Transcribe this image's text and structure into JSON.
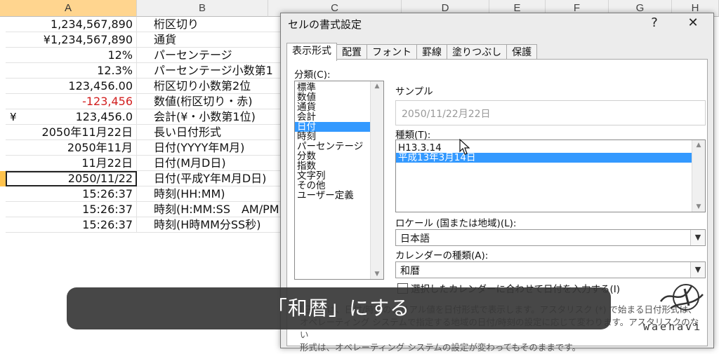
{
  "columns": [
    {
      "id": "A",
      "label": "A",
      "selected": true
    },
    {
      "id": "B",
      "label": "B",
      "selected": false
    },
    {
      "id": "C",
      "label": "C",
      "selected": false
    },
    {
      "id": "D",
      "label": "D",
      "selected": false
    },
    {
      "id": "E",
      "label": "E",
      "selected": false
    },
    {
      "id": "F",
      "label": "F",
      "selected": false
    },
    {
      "id": "G",
      "label": "G",
      "selected": false
    },
    {
      "id": "H",
      "label": "H",
      "selected": false
    }
  ],
  "rows": [
    {
      "a": "1,234,567,890",
      "b": "桁区切り"
    },
    {
      "a": "¥1,234,567,890",
      "b": "通貨"
    },
    {
      "a": "12%",
      "b": "パーセンテージ"
    },
    {
      "a": "12.3%",
      "b": "パーセンテージ小数第1"
    },
    {
      "a": "123,456.00",
      "b": "桁区切り小数第2位"
    },
    {
      "a": "-123,456",
      "b": "数値(桁区切り・赤)",
      "a_color": "#d21f1f"
    },
    {
      "a": "123,456.0",
      "b": "会計(¥・小数第1位)",
      "currency": "¥"
    },
    {
      "a": "2050年11月22日",
      "b": "長い日付形式"
    },
    {
      "a": "2050年11月",
      "b": "日付(YYYY年M月)"
    },
    {
      "a": "11月22日",
      "b": "日付(M月D日)"
    },
    {
      "a": "2050/11/22",
      "b": "日付(平成Y年M月D日)",
      "active": true
    },
    {
      "a": "15:26:37",
      "b": "時刻(HH:MM)"
    },
    {
      "a": "15:26:37",
      "b": "時刻(H:MM:SS　AM/PM"
    },
    {
      "a": "15:26:37",
      "b": "時刻(H時MM分SS秒)"
    }
  ],
  "dialog": {
    "title": "セルの書式設定",
    "help_label": "?",
    "close_label": "✕",
    "tabs": [
      "表示形式",
      "配置",
      "フォント",
      "罫線",
      "塗りつぶし",
      "保護"
    ],
    "active_tab": 0,
    "category_label": "分類(C):",
    "categories": [
      "標準",
      "数値",
      "通貨",
      "会計",
      "日付",
      "時刻",
      "パーセンテージ",
      "分数",
      "指数",
      "文字列",
      "その他",
      "ユーザー定義"
    ],
    "selected_category": 4,
    "sample_label": "サンプル",
    "sample_value": "2050/11/22月22日",
    "type_label": "種類(T):",
    "types": [
      "H13.3.14",
      "平成13年3月14日"
    ],
    "selected_type": 1,
    "locale_label": "ロケール (国または地域)(L):",
    "locale_value": "日本語",
    "calendar_label": "カレンダーの種類(A):",
    "calendar_value": "和暦",
    "checkbox_label": "選択したカレンダーに合わせて日付を入力する(I)",
    "description_line1": "[日付] は、日付/時刻のシリアル値を日付形式で表示します。アスタリスク (*) で始まる日付形式は、",
    "description_line2": "オペレーティング システムで指定する地域の日付/時刻の設定に応じて変わります。アスタリスクのない",
    "description_line3": "形式は、オペレーティング システムの設定が変わってもそのままです。"
  },
  "caption": "「和暦」にする",
  "logo_text": "waenavi"
}
